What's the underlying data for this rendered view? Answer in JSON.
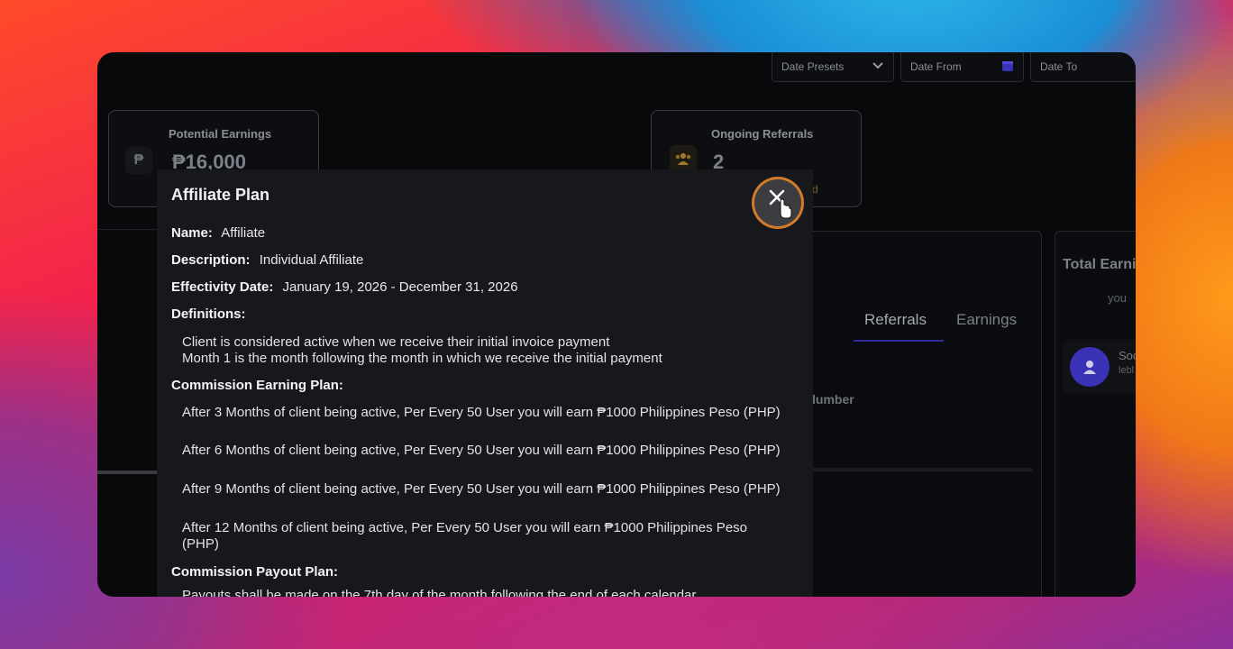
{
  "filters": {
    "date_presets": "Date Presets",
    "date_from": "Date From",
    "date_to": "Date To"
  },
  "cards": {
    "potential_earnings": {
      "label": "Potential Earnings",
      "value": "₱16,000",
      "icon": "peso-icon"
    },
    "ongoing_referrals": {
      "label": "Ongoing Referrals",
      "value": "2",
      "icon": "users-icon"
    }
  },
  "background": {
    "tabs": [
      "Referrals",
      "Earnings"
    ],
    "total_earnings_label": "Total Earni",
    "right_you": "you",
    "column_number": "lumber",
    "user_name_fragment": "Soc",
    "user_sub_fragment": "lebl",
    "card_suffix": "d"
  },
  "modal": {
    "title": "Affiliate Plan",
    "name_label": "Name:",
    "name_value": "Affiliate",
    "description_label": "Description:",
    "description_value": "Individual Affiliate",
    "effectivity_label": "Effectivity Date:",
    "effectivity_value": "January 19, 2026 - December 31, 2026",
    "definitions_label": "Definitions:",
    "definitions": [
      "Client is considered active when we receive their initial invoice payment",
      "Month 1 is the month following the month in which we receive the initial payment"
    ],
    "commission_earning_label": "Commission Earning Plan:",
    "commission_earning": [
      "After 3 Months of client being active, Per Every 50 User you will earn ₱1000 Philippines Peso (PHP)",
      "After 6 Months of client being active, Per Every 50 User you will earn ₱1000 Philippines Peso (PHP)",
      "After 9 Months of client being active, Per Every 50 User you will earn ₱1000 Philippines Peso (PHP)",
      "After 12 Months of client being active, Per Every 50 User you will earn ₱1000 Philippines Peso (PHP)"
    ],
    "commission_payout_label": "Commission Payout Plan:",
    "commission_payout": "Payouts shall be made on the 7th day of the month following the end of each calendar"
  },
  "colors": {
    "accent_orange": "#d37a2b",
    "accent_purple": "#3a33b8"
  }
}
